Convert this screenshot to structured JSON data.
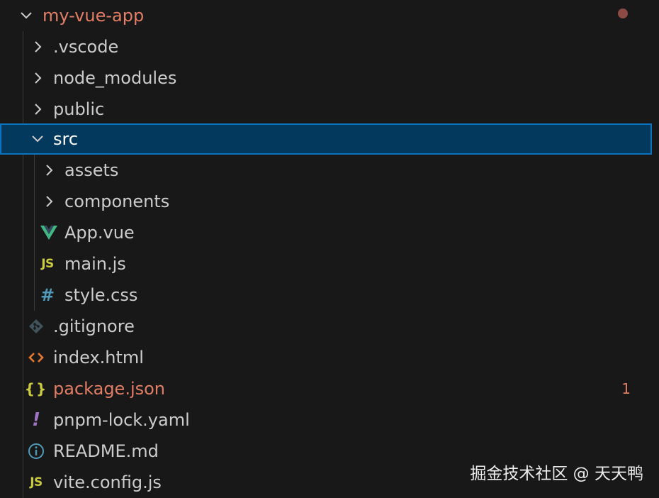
{
  "explorer": {
    "root": {
      "label": "my-vue-app",
      "expanded": true,
      "status_dot_color": "#8b4a44"
    },
    "items": [
      {
        "label": ".vscode",
        "type": "folder",
        "expanded": false
      },
      {
        "label": "node_modules",
        "type": "folder",
        "expanded": false
      },
      {
        "label": "public",
        "type": "folder",
        "expanded": false
      },
      {
        "label": "src",
        "type": "folder",
        "expanded": true,
        "selected": true
      },
      {
        "label": "assets",
        "type": "folder",
        "expanded": false
      },
      {
        "label": "components",
        "type": "folder",
        "expanded": false
      },
      {
        "label": "App.vue",
        "type": "file",
        "icon": "vue-icon"
      },
      {
        "label": "main.js",
        "type": "file",
        "icon": "js-icon",
        "icon_text": "JS"
      },
      {
        "label": "style.css",
        "type": "file",
        "icon": "css-icon",
        "icon_text": "#"
      },
      {
        "label": ".gitignore",
        "type": "file",
        "icon": "git-icon"
      },
      {
        "label": "index.html",
        "type": "file",
        "icon": "html-icon"
      },
      {
        "label": "package.json",
        "type": "file",
        "icon": "json-icon",
        "icon_text": "{}",
        "modified": true,
        "badge": "1"
      },
      {
        "label": "pnpm-lock.yaml",
        "type": "file",
        "icon": "yaml-icon",
        "icon_text": "!"
      },
      {
        "label": "README.md",
        "type": "file",
        "icon": "info-icon"
      },
      {
        "label": "vite.config.js",
        "type": "file",
        "icon": "js-icon",
        "icon_text": "JS"
      }
    ]
  },
  "watermark": {
    "text": "掘金技术社区 @ 天天鸭"
  },
  "colors": {
    "background": "#181818",
    "selection_bg": "#04395e",
    "selection_border": "#0e73be",
    "modified_text": "#e27d66",
    "vue_green": "#41b883",
    "js_yellow": "#cbcb41",
    "css_blue": "#519aba",
    "html_orange": "#e37933",
    "yaml_purple": "#a074c4"
  }
}
